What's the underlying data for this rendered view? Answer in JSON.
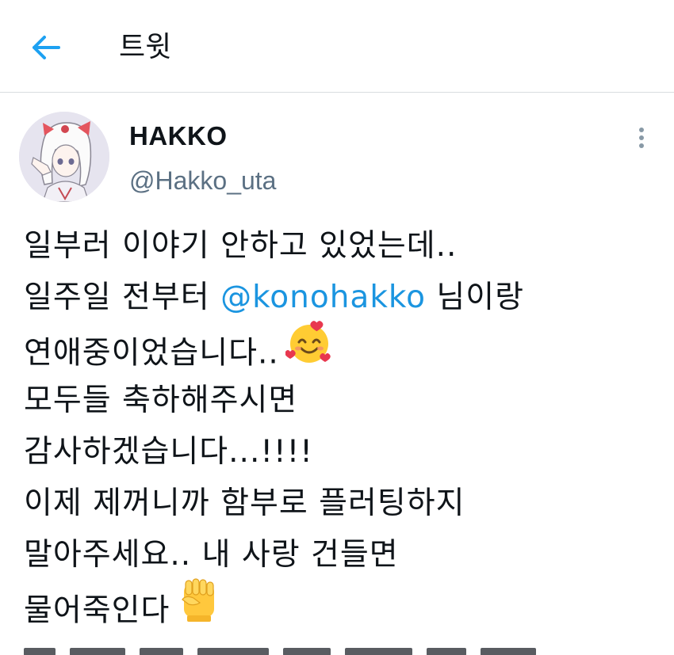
{
  "header": {
    "title": "트윗"
  },
  "tweet": {
    "author": {
      "display_name": "HAKKO",
      "handle": "@Hakko_uta"
    },
    "lines": [
      {
        "text": "일부러 이야기 안하고 있었는데.."
      },
      {
        "before": "일주일 전부터 ",
        "mention": "@konohakko",
        "after": " 님이랑"
      },
      {
        "text": "연애중이었습니다.."
      },
      {
        "text": "모두들 축하해주시면"
      },
      {
        "text": "감사하겠습니다...!!!!"
      },
      {
        "text": "이제 제꺼니까 함부로 플러팅하지"
      },
      {
        "text": "말아주세요.. 내 사랑 건들면"
      },
      {
        "text": "물어죽인다"
      }
    ]
  },
  "icons": {
    "back": "arrow-left-icon",
    "more": "more-vertical-icon",
    "emoji_love": "smiling-face-with-hearts-icon",
    "emoji_fist": "raised-fist-icon"
  },
  "colors": {
    "accent": "#1b95e0",
    "text": "#0f1419",
    "secondary": "#5b7083",
    "divider": "#d9dde0"
  }
}
